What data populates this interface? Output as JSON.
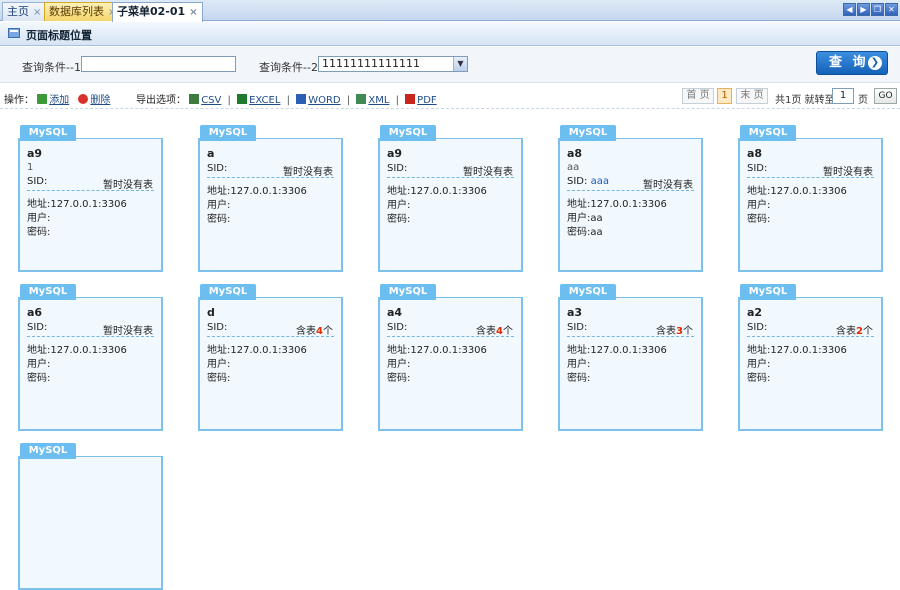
{
  "tabs": [
    {
      "label": "主页",
      "close": "×"
    },
    {
      "label": "数据库列表",
      "close": "×"
    },
    {
      "label": "子菜单02-01",
      "close": "×"
    }
  ],
  "title": "页面标题位置",
  "search": {
    "label1": "查询条件--1：",
    "value1": "",
    "label2": "查询条件--2：",
    "value2": "11111111111111",
    "button": "查 询"
  },
  "toolbar": {
    "ops_label": "操作：",
    "add": "添加",
    "delete": "删除",
    "export_label": "导出选项：",
    "csv": "CSV",
    "excel": "EXCEL",
    "word": "WORD",
    "xml": "XML",
    "pdf": "PDF",
    "sep": "|"
  },
  "pager": {
    "first": "首 页",
    "current": "1",
    "last": "末 页",
    "total": "共1页 就转至",
    "page_input": "1",
    "page_unit": "页",
    "go": "GO"
  },
  "card_labels": {
    "header": "MySQL",
    "sid": "SID:",
    "addr": "地址:",
    "user": "用户:",
    "pwd": "密码:"
  },
  "cards": [
    {
      "name": "a9",
      "sub": "1",
      "sid": "",
      "tables": "暂时没有表",
      "count": "",
      "addr": "127.0.0.1:3306",
      "user": "",
      "pwd": ""
    },
    {
      "name": "a",
      "sub": "",
      "sid": "",
      "tables": "暂时没有表",
      "count": "",
      "addr": "127.0.0.1:3306",
      "user": "",
      "pwd": ""
    },
    {
      "name": "a9",
      "sub": "",
      "sid": "",
      "tables": "暂时没有表",
      "count": "",
      "addr": "127.0.0.1:3306",
      "user": "",
      "pwd": ""
    },
    {
      "name": "a8",
      "sub": "aa",
      "sid": "aaa",
      "tables": "暂时没有表",
      "count": "",
      "addr": "127.0.0.1:3306",
      "user": "aa",
      "pwd": "aa"
    },
    {
      "name": "a8",
      "sub": "",
      "sid": "",
      "tables": "暂时没有表",
      "count": "",
      "addr": "127.0.0.1:3306",
      "user": "",
      "pwd": ""
    },
    {
      "name": "a6",
      "sub": "",
      "sid": "",
      "tables": "暂时没有表",
      "count": "",
      "addr": "127.0.0.1:3306",
      "user": "",
      "pwd": ""
    },
    {
      "name": "d",
      "sub": "",
      "sid": "",
      "tables": "含表",
      "count": "4",
      "unit": "个",
      "addr": "127.0.0.1:3306",
      "user": "",
      "pwd": ""
    },
    {
      "name": "a4",
      "sub": "",
      "sid": "",
      "tables": "含表",
      "count": "4",
      "unit": "个",
      "addr": "127.0.0.1:3306",
      "user": "",
      "pwd": ""
    },
    {
      "name": "a3",
      "sub": "",
      "sid": "",
      "tables": "含表",
      "count": "3",
      "unit": "个",
      "addr": "127.0.0.1:3306",
      "user": "",
      "pwd": ""
    },
    {
      "name": "a2",
      "sub": "",
      "sid": "",
      "tables": "含表",
      "count": "2",
      "unit": "个",
      "addr": "127.0.0.1:3306",
      "user": "",
      "pwd": ""
    },
    {
      "name": "",
      "sub": "",
      "sid": "",
      "tables": "",
      "count": "",
      "addr": "",
      "user": "",
      "pwd": ""
    }
  ]
}
